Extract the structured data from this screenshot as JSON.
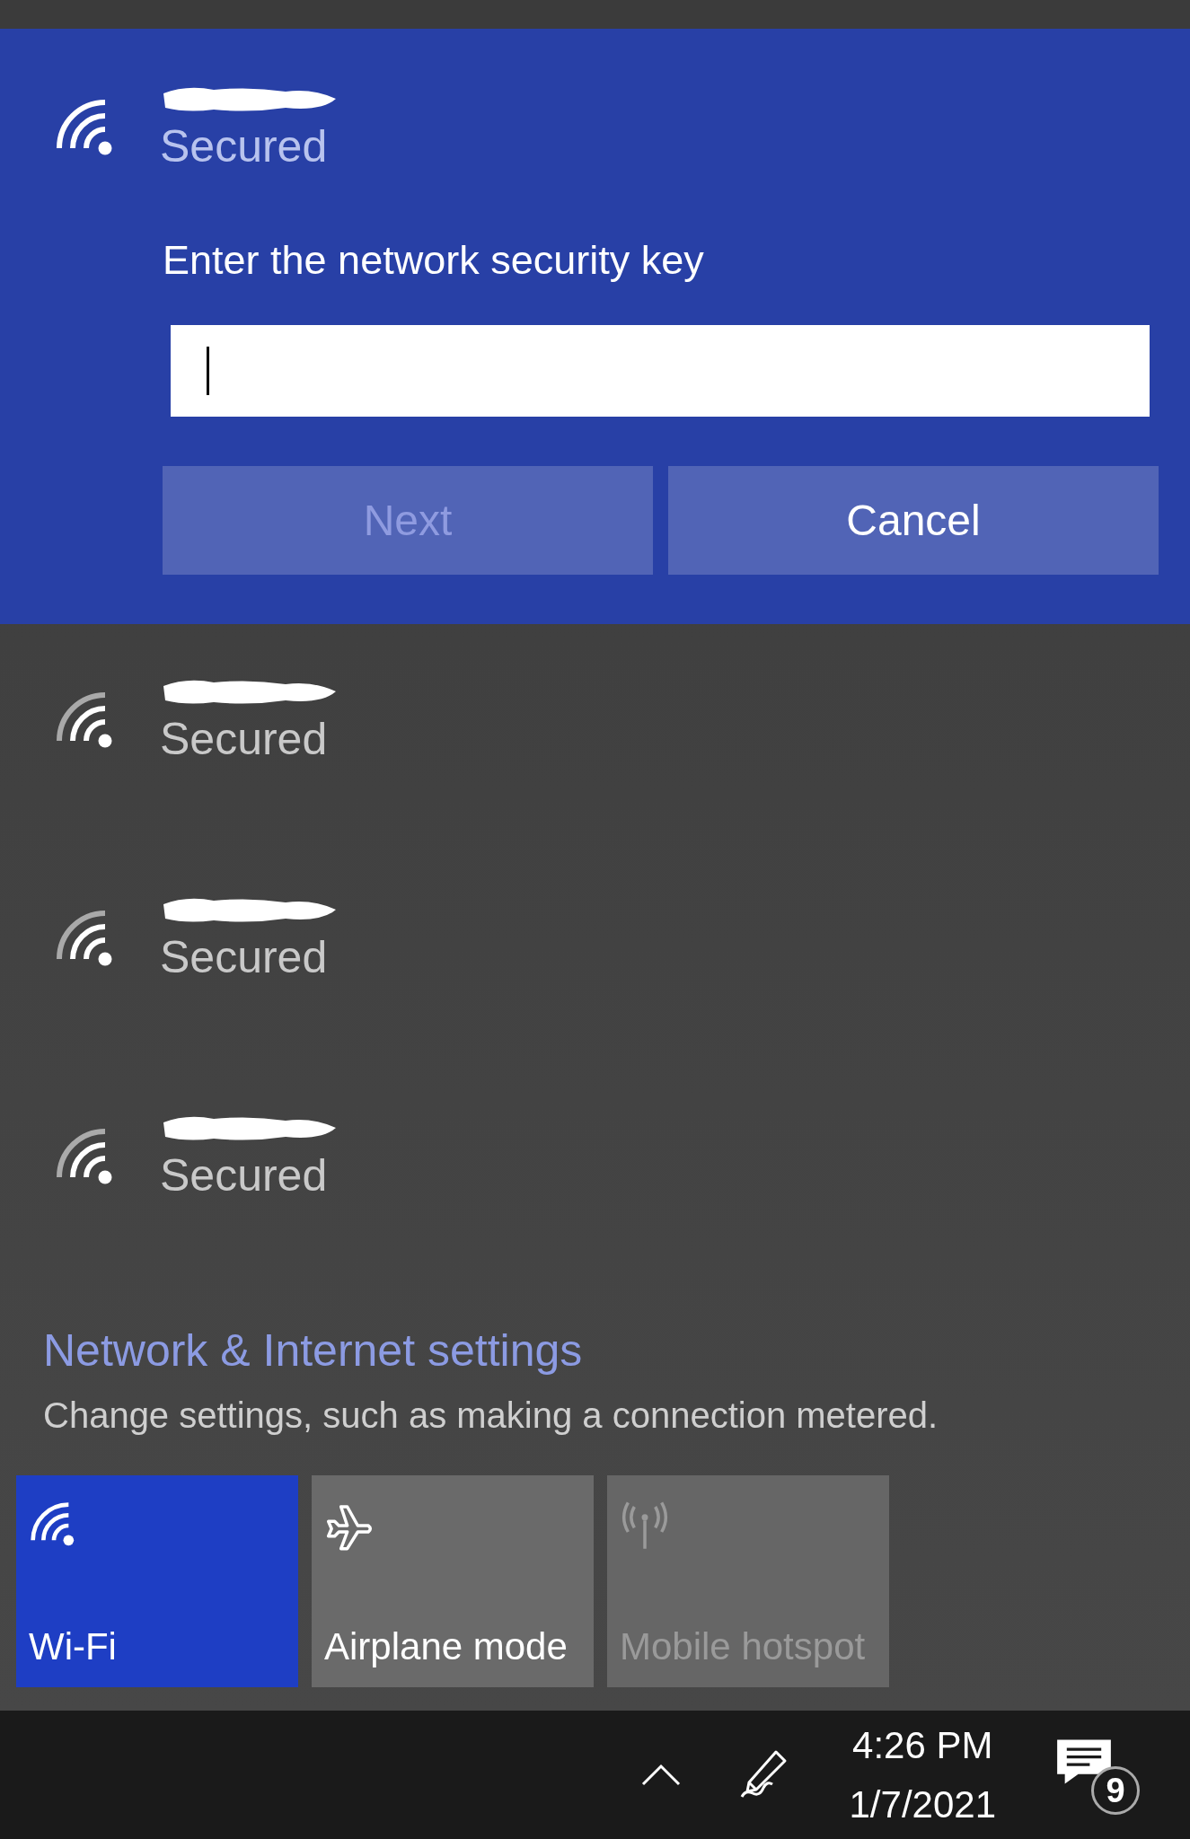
{
  "networks": [
    {
      "status": "Secured",
      "expanded": true,
      "prompt": "Enter the network security key",
      "buttons": [
        {
          "label": "Next",
          "disabled": true
        },
        {
          "label": "Cancel",
          "disabled": false
        }
      ]
    },
    {
      "status": "Secured",
      "expanded": false
    },
    {
      "status": "Secured",
      "expanded": false
    },
    {
      "status": "Secured",
      "expanded": false
    }
  ],
  "settings_link": {
    "title": "Network & Internet settings",
    "description": "Change settings, such as making a connection metered."
  },
  "quick_actions": [
    {
      "kind": "wifi",
      "label": "Wi-Fi",
      "on": true,
      "disabled": false
    },
    {
      "kind": "airplane",
      "label": "Airplane mode",
      "on": false,
      "disabled": false
    },
    {
      "kind": "hotspot",
      "label": "Mobile hotspot",
      "on": false,
      "disabled": true
    }
  ],
  "taskbar": {
    "time": "4:26 PM",
    "date": "1/7/2021",
    "notification_count": "9"
  }
}
